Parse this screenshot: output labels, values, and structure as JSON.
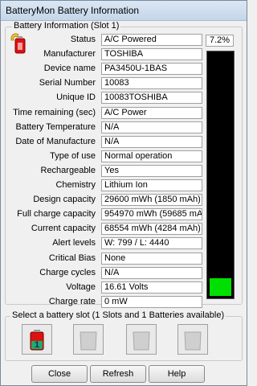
{
  "window": {
    "title": "BatteryMon Battery Information"
  },
  "info_group": {
    "legend": "Battery Information (Slot 1)",
    "fields": [
      {
        "label": "Status",
        "value": "A/C Powered"
      },
      {
        "label": "Manufacturer",
        "value": "TOSHIBA"
      },
      {
        "label": "Device name",
        "value": "PA3450U-1BAS"
      },
      {
        "label": "Serial Number",
        "value": "10083"
      },
      {
        "label": "Unique ID",
        "value": "10083TOSHIBA"
      },
      {
        "label": "Time remaining (sec)",
        "value": "A/C Power"
      },
      {
        "label": "Battery Temperature",
        "value": "N/A"
      },
      {
        "label": "Date of Manufacture",
        "value": "N/A"
      },
      {
        "label": "Type of use",
        "value": "Normal operation"
      },
      {
        "label": "Rechargeable",
        "value": "Yes"
      },
      {
        "label": "Chemistry",
        "value": "Lithium Ion"
      },
      {
        "label": "Design capacity",
        "value": "29600 mWh (1850 mAh)"
      },
      {
        "label": "Full charge capacity",
        "value": "954970 mWh (59685 mAh)"
      },
      {
        "label": "Current capacity",
        "value": "68554 mWh (4284 mAh)"
      },
      {
        "label": "Alert levels",
        "value": "W: 799 / L: 4440"
      },
      {
        "label": "Critical Bias",
        "value": "None"
      },
      {
        "label": "Charge cycles",
        "value": "N/A"
      },
      {
        "label": "Voltage",
        "value": "16.61 Volts"
      },
      {
        "label": "Charge rate",
        "value": "0 mW"
      }
    ],
    "charge_percent_text": "7.2%",
    "charge_level": 0.072,
    "gauge_color": "#00e000"
  },
  "slots": {
    "legend": "Select a battery slot (1 Slots and 1 Batteries available)",
    "items": [
      {
        "state": "active",
        "label": "1"
      },
      {
        "state": "empty"
      },
      {
        "state": "empty"
      },
      {
        "state": "empty"
      }
    ]
  },
  "buttons": {
    "close": "Close",
    "refresh": "Refresh",
    "help": "Help"
  }
}
